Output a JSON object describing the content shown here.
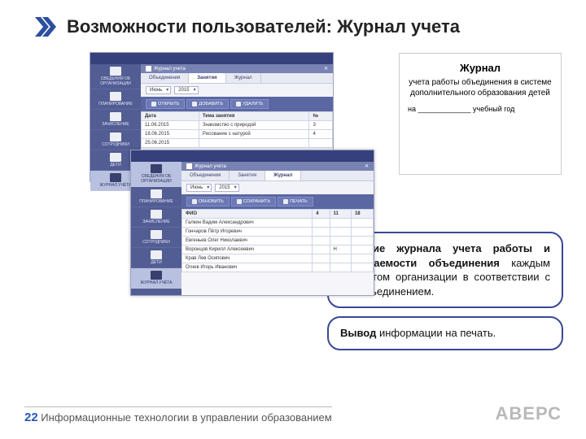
{
  "title": "Возможности пользователей: Журнал учета",
  "journal": {
    "heading": "Журнал",
    "body": "учета работы объединения в системе дополнительного образования детей",
    "line": "на _____________ учебный год"
  },
  "app1": {
    "crumb": "Журнал учета",
    "tabs": [
      "Объединения",
      "Занятия",
      "Журнал"
    ],
    "activeTab": 1,
    "filters": {
      "month": "Июнь",
      "year": "2015"
    },
    "buttons": [
      "ОТКРЫТЬ",
      "ДОБАВИТЬ",
      "УДАЛИТЬ"
    ],
    "cols": [
      "Дата",
      "Тема занятия",
      "№"
    ],
    "rows": [
      [
        "11.06.2015",
        "Знакомство с природой",
        "3"
      ],
      [
        "18.06.2015",
        "Рисование с натурой",
        "4"
      ],
      [
        "25.06.2015",
        "",
        ""
      ]
    ]
  },
  "app2": {
    "crumb": "Журнал учета",
    "tabs": [
      "Объединения",
      "Занятия",
      "Журнал"
    ],
    "activeTab": 2,
    "filters": {
      "month": "Июнь",
      "year": "2015"
    },
    "buttons": [
      "ОБНОВИТЬ",
      "СОХРАНИТЬ",
      "ПЕЧАТЬ"
    ],
    "cols": [
      "ФИО",
      "4",
      "11",
      "18"
    ],
    "rows": [
      [
        "Галкин Вадим Александрович",
        "",
        "",
        ""
      ],
      [
        "Гончаров Пётр Игоревич",
        "",
        "",
        ""
      ],
      [
        "Евгеньев Олег Николаевич",
        "",
        "",
        ""
      ],
      [
        "Воронцов Кирилл Алексеевич",
        "",
        "Н",
        ""
      ],
      [
        "Крав Лев Осипович",
        "",
        "",
        ""
      ],
      [
        "Огнев Игорь Иванович",
        "",
        "",
        ""
      ]
    ]
  },
  "sidebar": [
    "СВЕДЕНИЯ ОБ ОРГАНИЗАЦИИ",
    "ПЛАНИРОВАНИЕ",
    "ЗАЧИСЛЕНИЕ",
    "СОТРУДНИКИ",
    "ДЕТИ",
    "ЖУРНАЛ УЧЁТА"
  ],
  "bubbles": {
    "b1a": "Ведение журнала учета работы и посещаемости объединения",
    "b1b": " каждым педагогом организации в соответствии с его объединением.",
    "b2a": "Вывод",
    "b2b": " информации на печать."
  },
  "footer": {
    "page": "22",
    "text": " Информационные технологии в управлении образованием",
    "brand": "АВЕРС"
  }
}
